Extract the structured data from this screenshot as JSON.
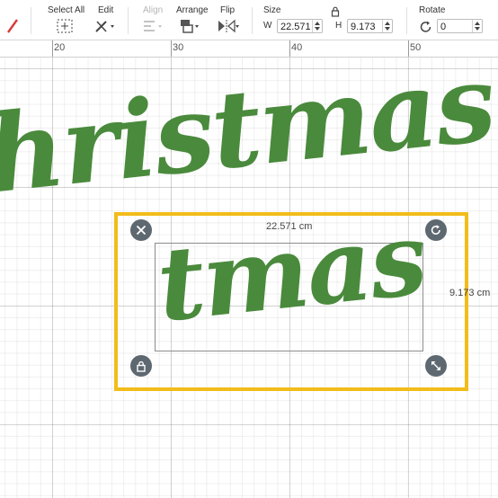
{
  "toolbar": {
    "select_all_label": "Select All",
    "edit_label": "Edit",
    "align_label": "Align",
    "arrange_label": "Arrange",
    "flip_label": "Flip",
    "size_label": "Size",
    "width_letter": "W",
    "width_value": "22.571",
    "height_letter": "H",
    "height_value": "9.173",
    "rotate_label": "Rotate",
    "rotate_value": "0"
  },
  "ruler": {
    "ticks": [
      "20",
      "30",
      "40",
      "50"
    ]
  },
  "canvas": {
    "background_word": "hristmas",
    "selected_word": "tmas",
    "text_color": "#4a8a3c",
    "selection_color": "#f2bc1b",
    "width_dimension": "22.571 cm",
    "height_dimension": "9.173 cm"
  }
}
